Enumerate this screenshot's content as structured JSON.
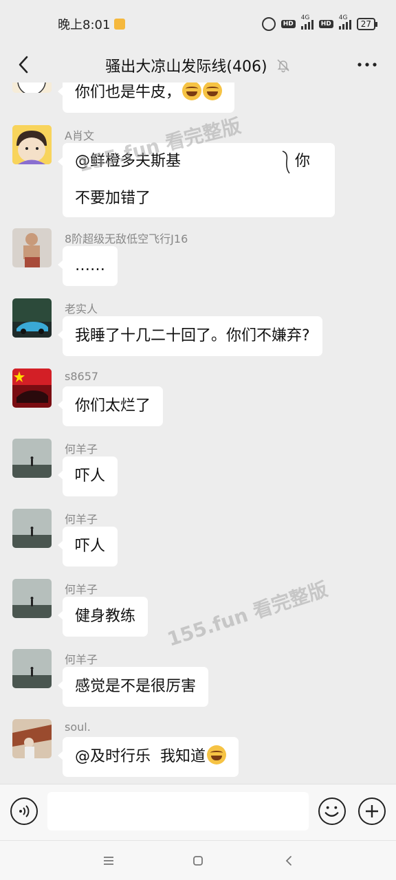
{
  "status_bar": {
    "time": "晚上8:01",
    "network_1": "4G",
    "network_2": "4G",
    "hd": "HD",
    "battery": "27"
  },
  "header": {
    "title": "骚出大凉山发际线(406)",
    "back_icon": "chevron-left-icon",
    "mute_icon": "bell-off-icon",
    "more_icon": "more-horizontal-icon"
  },
  "messages": [
    {
      "sender": "",
      "text": "你们也是牛皮，",
      "emoji": "laughing-crying-emoji x2"
    },
    {
      "sender": "A肖文",
      "line1": "@鲜橙多夫斯基",
      "line1_tail": "你",
      "line2": "不要加错了"
    },
    {
      "sender": "8阶超级无敌低空飞行J16",
      "text": "……"
    },
    {
      "sender": "老实人",
      "text": "我睡了十几二十回了。你们不嫌弃?"
    },
    {
      "sender": "s8657",
      "text": "你们太烂了"
    },
    {
      "sender": "何羊子",
      "text": "吓人"
    },
    {
      "sender": "何羊子",
      "text": "吓人"
    },
    {
      "sender": "何羊子",
      "text": "健身教练"
    },
    {
      "sender": "何羊子",
      "text": "感觉是不是很厉害"
    },
    {
      "sender": "soul.",
      "text": "@及时行乐  我知道",
      "emoji": "laughing-crying-emoji"
    }
  ],
  "watermarks": [
    "155.fun 看完整版",
    "155.fun 看完整版"
  ],
  "input": {
    "placeholder": ""
  },
  "colors": {
    "background": "#ededed",
    "bubble": "#ffffff",
    "sender": "#888888"
  }
}
